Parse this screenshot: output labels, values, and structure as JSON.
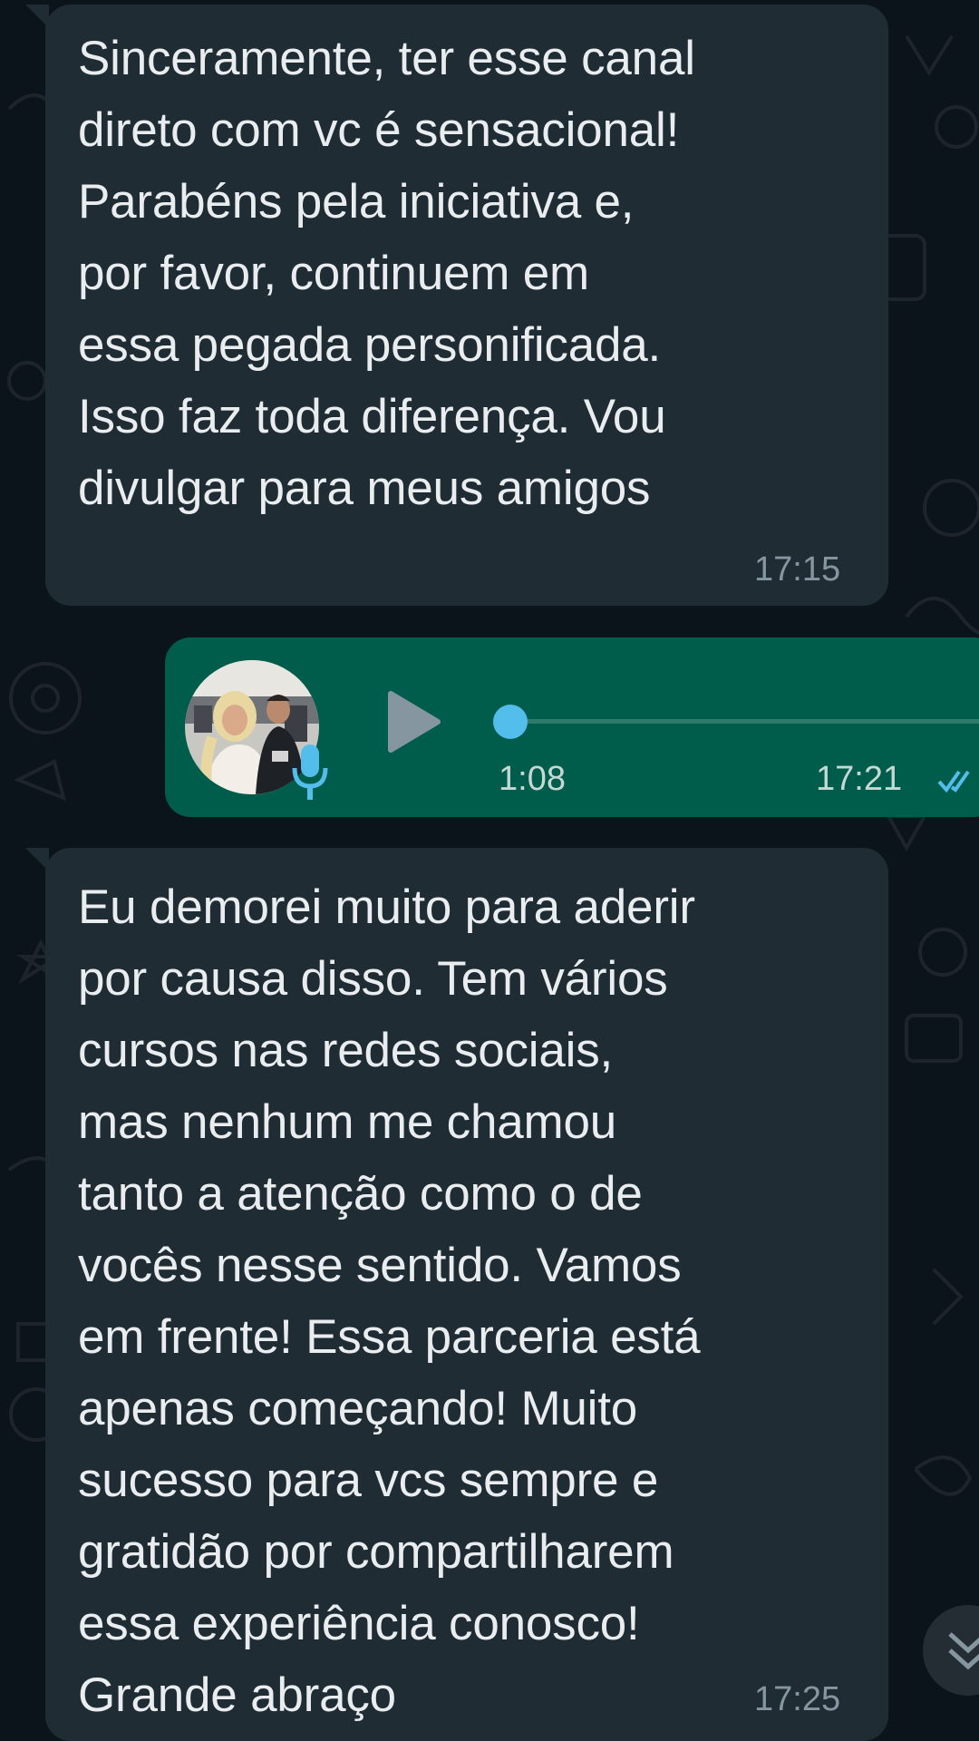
{
  "colors": {
    "chat_background": "#0b141a",
    "incoming_bubble": "#1f2c34",
    "outgoing_bubble": "#005c4b",
    "read_ticks": "#53bdeb",
    "text_primary": "#e9edef",
    "text_secondary": "#8696a0"
  },
  "messages": [
    {
      "direction": "incoming",
      "text": "Sinceramente, ter esse canal\ndireto com vc é sensacional!\nParabéns pela iniciativa e,\npor favor, continuem em\nessa pegada personificada.\nIsso faz toda diferença. Vou\ndivulgar para meus amigos",
      "time": "17:15"
    },
    {
      "direction": "outgoing",
      "type": "voice",
      "duration": "1:08",
      "time": "17:21",
      "status": "read",
      "playback_progress": 0
    },
    {
      "direction": "incoming",
      "text": "Eu demorei muito para aderir\npor causa disso. Tem vários\ncursos nas redes sociais,\nmas nenhum me chamou\ntanto a atenção como o de\nvocês nesse sentido. Vamos\nem frente! Essa parceria está\napenas começando! Muito\nsucesso para vcs sempre e\ngratidão por compartilharem\nessa experiência conosco!\nGrande abraço",
      "time": "17:25"
    }
  ],
  "icons": {
    "play": "play-icon",
    "mic": "mic-icon",
    "read_receipt": "double-check-icon",
    "scroll_down": "chevron-double-down-icon"
  }
}
